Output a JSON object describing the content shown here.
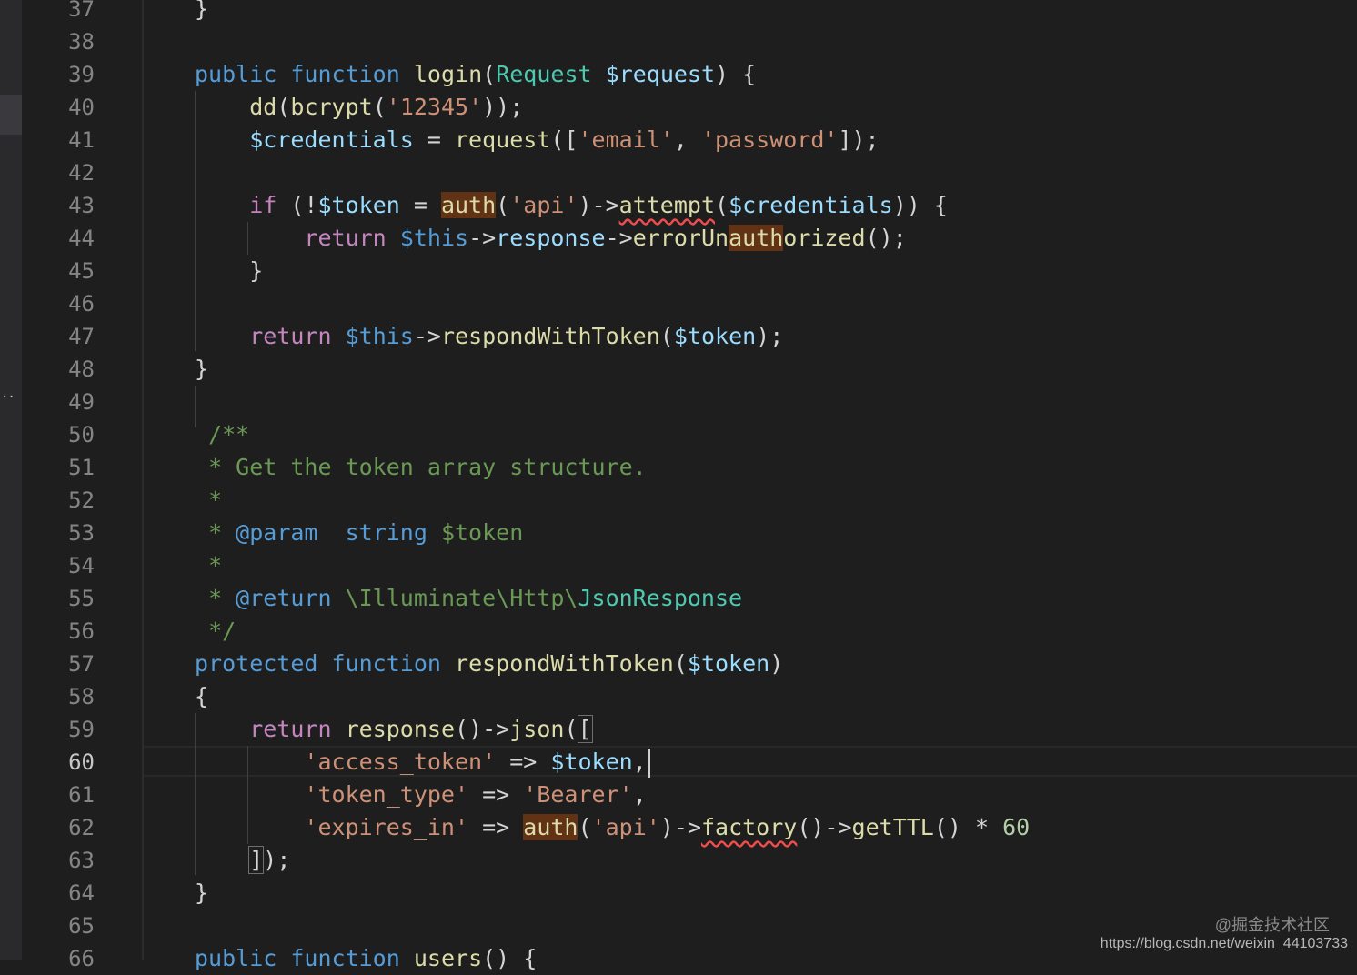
{
  "editor": {
    "active_line": "60",
    "line_numbers": [
      "37",
      "38",
      "39",
      "40",
      "41",
      "42",
      "43",
      "44",
      "45",
      "46",
      "47",
      "48",
      "49",
      "50",
      "51",
      "52",
      "53",
      "54",
      "55",
      "56",
      "57",
      "58",
      "59",
      "60",
      "61",
      "62",
      "63",
      "64",
      "65",
      "66"
    ]
  },
  "tokens": {
    "l37_a": "}",
    "l39_a": "public",
    "l39_b": " ",
    "l39_c": "function",
    "l39_d": " ",
    "l39_e": "login",
    "l39_f": "(",
    "l39_g": "Request",
    "l39_h": " ",
    "l39_i": "$request",
    "l39_j": ") {",
    "l40_a": "dd",
    "l40_b": "(",
    "l40_c": "bcrypt",
    "l40_d": "(",
    "l40_e": "'12345'",
    "l40_f": "));",
    "l41_a": "$credentials",
    "l41_b": " = ",
    "l41_c": "request",
    "l41_d": "([",
    "l41_e": "'email'",
    "l41_f": ", ",
    "l41_g": "'password'",
    "l41_h": "]);",
    "l43_a": "if",
    "l43_b": " (!",
    "l43_c": "$token",
    "l43_d": " = ",
    "l43_e": "auth",
    "l43_f": "(",
    "l43_g": "'api'",
    "l43_h": ")->",
    "l43_i": "attempt",
    "l43_j": "(",
    "l43_k": "$credentials",
    "l43_l": ")) {",
    "l44_a": "return",
    "l44_b": " ",
    "l44_c": "$this",
    "l44_d": "->",
    "l44_e": "response",
    "l44_f": "->",
    "l44_g": "errorUn",
    "l44_h": "auth",
    "l44_i": "orized",
    "l44_j": "();",
    "l45_a": "}",
    "l47_a": "return",
    "l47_b": " ",
    "l47_c": "$this",
    "l47_d": "->",
    "l47_e": "respondWithToken",
    "l47_f": "(",
    "l47_g": "$token",
    "l47_h": ");",
    "l48_a": "}",
    "l50_a": "/**",
    "l51_a": "* Get the token array structure.",
    "l52_a": "*",
    "l53_a": "* ",
    "l53_b": "@param",
    "l53_c": "  ",
    "l53_d": "string",
    "l53_e": " $token",
    "l54_a": "*",
    "l55_a": "* ",
    "l55_b": "@return",
    "l55_c": " \\Illuminate\\Http\\",
    "l55_d": "JsonResponse",
    "l56_a": "*/",
    "l57_a": "protected",
    "l57_b": " ",
    "l57_c": "function",
    "l57_d": " ",
    "l57_e": "respondWithToken",
    "l57_f": "(",
    "l57_g": "$token",
    "l57_h": ")",
    "l58_a": "{",
    "l59_a": "return",
    "l59_b": " ",
    "l59_c": "response",
    "l59_d": "()->",
    "l59_e": "json",
    "l59_f": "(",
    "l59_g": "[",
    "l60_a": "'access_token'",
    "l60_b": " => ",
    "l60_c": "$token",
    "l60_d": ",",
    "l61_a": "'token_type'",
    "l61_b": " => ",
    "l61_c": "'Bearer'",
    "l61_d": ",",
    "l62_a": "'expires_in'",
    "l62_b": " => ",
    "l62_c": "auth",
    "l62_d": "(",
    "l62_e": "'api'",
    "l62_f": ")->",
    "l62_g": "factory",
    "l62_h": "()->",
    "l62_i": "getTTL",
    "l62_j": "() * ",
    "l62_k": "60",
    "l63_a": "]",
    "l63_b": ");",
    "l64_a": "}",
    "l66_a": "public",
    "l66_b": " ",
    "l66_c": "function",
    "l66_d": " ",
    "l66_e": "users",
    "l66_f": "() {"
  },
  "watermark": {
    "line1": "@掘金技术社区",
    "line2": "https://blog.csdn.net/weixin_44103733"
  },
  "colors": {
    "background": "#1e1e1e",
    "keyword": "#569cd6",
    "control": "#c586c0",
    "function": "#dcdcaa",
    "type": "#4ec9b0",
    "variable": "#9cdcfe",
    "string": "#ce9178",
    "number": "#b5cea8",
    "comment": "#6a9955",
    "highlight": "#613214"
  }
}
